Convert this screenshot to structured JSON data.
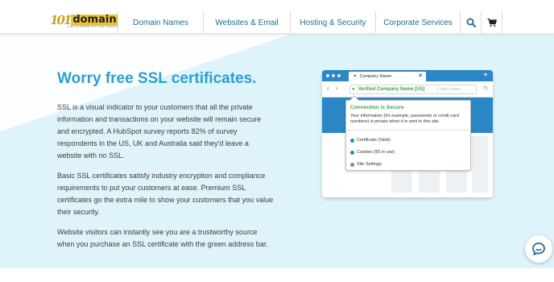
{
  "header": {
    "logo_text": "domain",
    "logo_mark": "101",
    "logo_tagline": "ONE HUNDRED AND ONE DOMAIN",
    "nav": [
      {
        "label": "Domain Names"
      },
      {
        "label": "Websites & Email"
      },
      {
        "label": "Hosting & Security"
      },
      {
        "label": "Corporate Services"
      }
    ],
    "icons": {
      "search": "search-icon",
      "cart": "cart-icon"
    }
  },
  "hero": {
    "title": "Worry free SSL certificates.",
    "paragraphs": [
      "SSL is a visual indicator to your customers that all the private information and transactions on your website will remain secure and encrypted. A HubSpot survey reports 82% of survey respondents in the US, UK and Australia said they'd leave a website with no SSL.",
      "Basic SSL certificates satisfy industry encryption and compliance requirements to put your customers at ease. Premium SSL certificates go the extra mile to show your customers that you value their security.",
      "Website visitors can instantly see you are a trustworthy source when you purchase an SSL certificate with the green address bar."
    ]
  },
  "browser": {
    "tab_title": "Company Name",
    "tab_close": "✕",
    "new_tab": "+",
    "back": "‹",
    "forward": "›",
    "verified_label": "Verified Company Name [US]",
    "url_placeholder": "https://www.",
    "popup": {
      "title": "Connection is Secure",
      "description": "Your information (for example, passwords or credit card numbers) is private when it is sent to this site.",
      "items": [
        {
          "label": "Certificate (Valid)"
        },
        {
          "label": "Cookies (55 in use)"
        },
        {
          "label": "Site Settings"
        }
      ]
    }
  },
  "colors": {
    "accent": "#2a9fd2",
    "nav_link": "#1d6f8f",
    "hero_bg": "#dff3fb",
    "secure_green": "#3aa54a",
    "browser_blue": "#2b87c6"
  },
  "chat": {
    "icon": "chat-icon"
  }
}
